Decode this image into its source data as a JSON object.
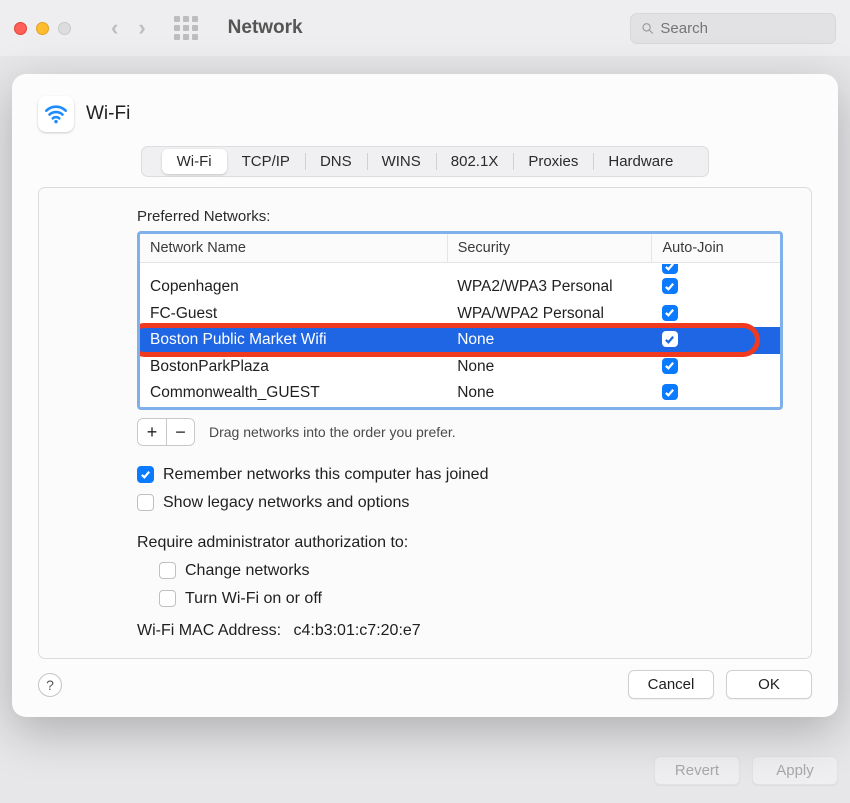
{
  "toolbar": {
    "title": "Network",
    "search_placeholder": "Search"
  },
  "sheet": {
    "title": "Wi-Fi",
    "tabs": [
      "Wi-Fi",
      "TCP/IP",
      "DNS",
      "WINS",
      "802.1X",
      "Proxies",
      "Hardware"
    ],
    "preferred_label": "Preferred Networks:",
    "columns": {
      "name": "Network Name",
      "security": "Security",
      "autojoin": "Auto-Join"
    },
    "networks": [
      {
        "name": "Copenhagen",
        "security": "WPA2/WPA3 Personal",
        "autojoin": true,
        "selected": false
      },
      {
        "name": "FC-Guest",
        "security": "WPA/WPA2 Personal",
        "autojoin": true,
        "selected": false
      },
      {
        "name": "Boston Public Market Wifi",
        "security": "None",
        "autojoin": true,
        "selected": true
      },
      {
        "name": "BostonParkPlaza",
        "security": "None",
        "autojoin": true,
        "selected": false
      },
      {
        "name": "Commonwealth_GUEST",
        "security": "None",
        "autojoin": true,
        "selected": false
      }
    ],
    "add_label": "+",
    "remove_label": "−",
    "drag_hint": "Drag networks into the order you prefer.",
    "remember_label": "Remember networks this computer has joined",
    "remember_checked": true,
    "legacy_label": "Show legacy networks and options",
    "legacy_checked": false,
    "authz_label": "Require administrator authorization to:",
    "authz_change_label": "Change networks",
    "authz_change_checked": false,
    "authz_toggle_label": "Turn Wi-Fi on or off",
    "authz_toggle_checked": false,
    "mac_label": "Wi-Fi MAC Address:",
    "mac_value": "c4:b3:01:c7:20:e7",
    "help_label": "?",
    "cancel_label": "Cancel",
    "ok_label": "OK"
  },
  "parent_footer": {
    "revert_label": "Revert",
    "apply_label": "Apply"
  }
}
